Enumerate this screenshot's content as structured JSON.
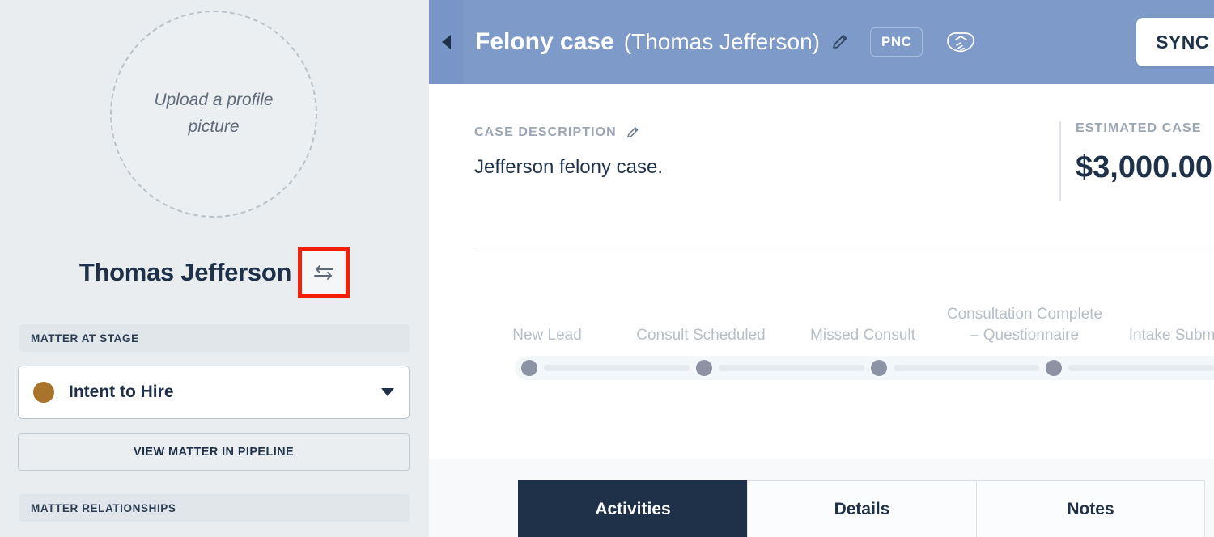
{
  "sidebar": {
    "avatar_placeholder": "Upload a profile picture",
    "client_name": "Thomas Jefferson",
    "swap_icon": "swap-arrows-icon",
    "stage_section_label": "MATTER AT STAGE",
    "stage_selected": "Intent to Hire",
    "stage_dot_color": "#a8742c",
    "pipeline_button_label": "VIEW MATTER IN PIPELINE",
    "relationships_section_label": "MATTER RELATIONSHIPS"
  },
  "header": {
    "collapse_icon": "triangle-left-icon",
    "case_title": "Felony case",
    "case_client": "(Thomas Jefferson)",
    "edit_icon": "pencil-icon",
    "pnc_badge": "PNC",
    "handshake_icon": "handshake-icon",
    "sync_button": "SYNC",
    "background_color": "#7d9ac9"
  },
  "main": {
    "description_kicker": "CASE DESCRIPTION",
    "description_edit_icon": "pencil-icon",
    "description_text": "Jefferson felony case.",
    "estimated_kicker": "ESTIMATED CASE",
    "estimated_value": "$3,000.00"
  },
  "tracker": {
    "stages": [
      "New Lead",
      "Consult Scheduled",
      "Missed Consult",
      "Consultation Complete – Questionnaire",
      "Intake Submitted"
    ],
    "node_color": "#8b93a4"
  },
  "tabs": [
    {
      "label": "Activities",
      "active": true
    },
    {
      "label": "Details",
      "active": false
    },
    {
      "label": "Notes",
      "active": false
    }
  ],
  "colors": {
    "accent_navy": "#1f3148",
    "header_blue": "#7d9ac9",
    "sidebar_bg": "#e9edf0",
    "highlight_box": "#f41f09"
  }
}
